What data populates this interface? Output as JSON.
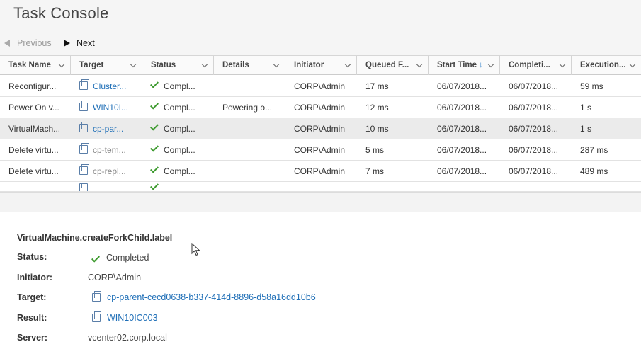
{
  "title": "Task Console",
  "pager": {
    "previous": "Previous",
    "next": "Next"
  },
  "columns": [
    "Task Name",
    "Target",
    "Status",
    "Details",
    "Initiator",
    "Queued F...",
    "Start Time",
    "Completi...",
    "Execution..."
  ],
  "sort_indicator": "↓",
  "rows": [
    {
      "task": "Reconfigur...",
      "target": "Cluster...",
      "status": "Compl...",
      "details": "",
      "initiator": "CORP\\Admin",
      "queued": "17 ms",
      "start": "06/07/2018...",
      "completion": "06/07/2018...",
      "execution": "59 ms"
    },
    {
      "task": "Power On v...",
      "target": "WIN10I...",
      "status": "Compl...",
      "details": "Powering o...",
      "initiator": "CORP\\Admin",
      "queued": "12 ms",
      "start": "06/07/2018...",
      "completion": "06/07/2018...",
      "execution": "1 s"
    },
    {
      "task": "VirtualMach...",
      "target": "cp-par...",
      "status": "Compl...",
      "details": "",
      "initiator": "CORP\\Admin",
      "queued": "10 ms",
      "start": "06/07/2018...",
      "completion": "06/07/2018...",
      "execution": "1 s"
    },
    {
      "task": "Delete virtu...",
      "target": "cp-tem...",
      "status": "Compl...",
      "details": "",
      "initiator": "CORP\\Admin",
      "queued": "5 ms",
      "start": "06/07/2018...",
      "completion": "06/07/2018...",
      "execution": "287 ms"
    },
    {
      "task": "Delete virtu...",
      "target": "cp-repl...",
      "status": "Compl...",
      "details": "",
      "initiator": "CORP\\Admin",
      "queued": "7 ms",
      "start": "06/07/2018...",
      "completion": "06/07/2018...",
      "execution": "489 ms"
    }
  ],
  "detail": {
    "title": "VirtualMachine.createForkChild.label",
    "status_label": "Status:",
    "status_value": "Completed",
    "initiator_label": "Initiator:",
    "initiator_value": "CORP\\Admin",
    "target_label": "Target:",
    "target_value": "cp-parent-cecd0638-b337-414d-8896-d58a16dd10b6",
    "result_label": "Result:",
    "result_value": "WIN10IC003",
    "server_label": "Server:",
    "server_value": "vcenter02.corp.local"
  },
  "colors": {
    "link": "#1f6fb7",
    "check": "#3d9a2e",
    "selected_row": "#ebebeb"
  }
}
